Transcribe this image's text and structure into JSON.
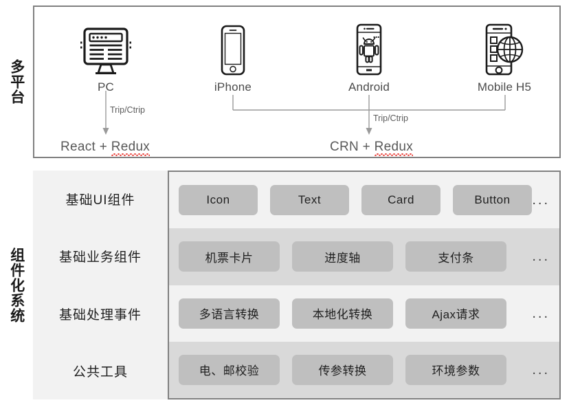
{
  "sections": {
    "platform": {
      "vertical_label": "多平台",
      "devices": [
        {
          "icon": "desktop-monitor-icon",
          "label": "PC"
        },
        {
          "icon": "iphone-icon",
          "label": "iPhone"
        },
        {
          "icon": "android-phone-icon",
          "label": "Android"
        },
        {
          "icon": "mobile-globe-icon",
          "label": "Mobile H5"
        }
      ],
      "flows": [
        {
          "label": "Trip/Ctrip",
          "target": "React + Redux"
        },
        {
          "label": "Trip/Ctrip",
          "target": "CRN + Redux"
        }
      ],
      "stacks": [
        {
          "prefix": "React + ",
          "flagged": "Redux"
        },
        {
          "prefix": "CRN + ",
          "flagged": "Redux"
        }
      ]
    },
    "component_system": {
      "vertical_label": "组件化系统",
      "rows": [
        {
          "category": "基础UI组件",
          "items": [
            "Icon",
            "Text",
            "Card",
            "Button"
          ],
          "ellipsis": "..."
        },
        {
          "category": "基础业务组件",
          "items": [
            "机票卡片",
            "进度轴",
            "支付条"
          ],
          "ellipsis": "..."
        },
        {
          "category": "基础处理事件",
          "items": [
            "多语言转换",
            "本地化转换",
            "Ajax请求"
          ],
          "ellipsis": "..."
        },
        {
          "category": "公共工具",
          "items": [
            "电、邮校验",
            "传参转换",
            "环境参数"
          ],
          "ellipsis": "..."
        }
      ]
    }
  },
  "colors": {
    "panel_border": "#808080",
    "row_light": "#f2f2f2",
    "row_dark": "#d9d9d9",
    "pill": "#bfbfbf",
    "connector": "#9a9a9a",
    "spellcheck_underline": "#e8403a"
  }
}
